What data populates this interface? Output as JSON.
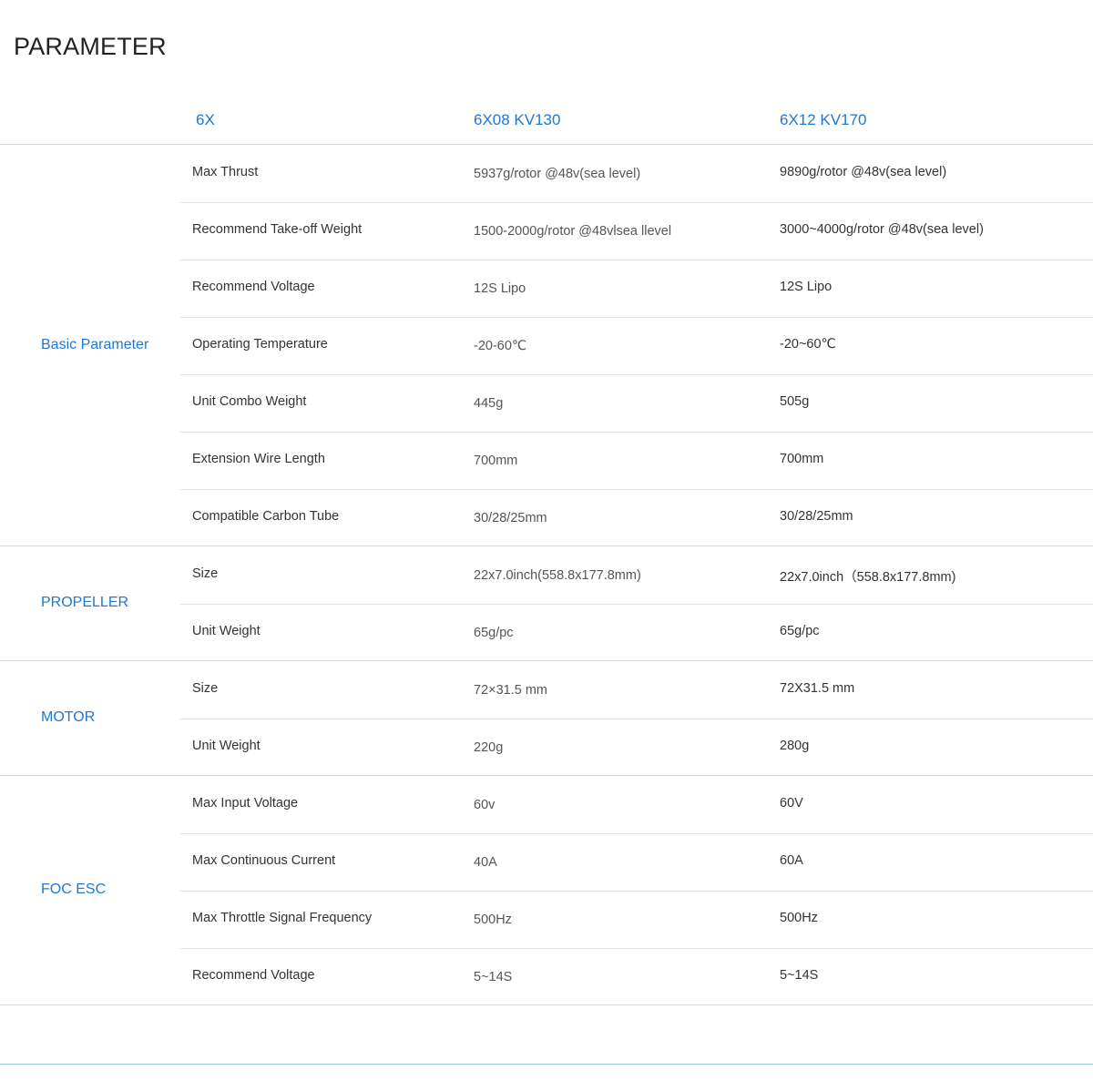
{
  "title": "PARAMETER",
  "header": {
    "col0": "6X",
    "col1": "6X08 KV130",
    "col2": "6X12 KV170"
  },
  "sections": [
    {
      "label": "Basic Parameter",
      "rows": [
        {
          "param": "Max Thrust",
          "v1": "5937g/rotor @48v(sea level)",
          "v2": "9890g/rotor @48v(sea level)"
        },
        {
          "param": "Recommend Take-off Weight",
          "v1": "1500-2000g/rotor @48vlsea llevel",
          "v2": "3000~4000g/rotor @48v(sea level)"
        },
        {
          "param": "Recommend Voltage",
          "v1": "12S Lipo",
          "v2": "12S Lipo"
        },
        {
          "param": "Operating Temperature",
          "v1": "-20-60℃",
          "v2": "-20~60℃"
        },
        {
          "param": "Unit Combo Weight",
          "v1": "445g",
          "v2": "505g"
        },
        {
          "param": "Extension Wire Length",
          "v1": "700mm",
          "v2": "700mm"
        },
        {
          "param": "Compatible Carbon Tube",
          "v1": "30/28/25mm",
          "v2": "30/28/25mm"
        }
      ]
    },
    {
      "label": "PROPELLER",
      "rows": [
        {
          "param": "Size",
          "v1": "22x7.0inch(558.8x177.8mm)",
          "v2": "22x7.0inch（558.8x177.8mm)"
        },
        {
          "param": "Unit Weight",
          "v1": "65g/pc",
          "v2": "65g/pc"
        }
      ]
    },
    {
      "label": "MOTOR",
      "rows": [
        {
          "param": "Size",
          "v1": "72×31.5 mm",
          "v2": "72X31.5 mm"
        },
        {
          "param": "Unit Weight",
          "v1": "220g",
          "v2": "280g"
        }
      ]
    },
    {
      "label": "FOC ESC",
      "rows": [
        {
          "param": "Max Input Voltage",
          "v1": "60v",
          "v2": "60V"
        },
        {
          "param": "Max Continuous Current",
          "v1": "40A",
          "v2": "60A"
        },
        {
          "param": "Max Throttle Signal Frequency",
          "v1": "500Hz",
          "v2": "500Hz"
        },
        {
          "param": "Recommend Voltage",
          "v1": "5~14S",
          "v2": "5~14S"
        }
      ]
    }
  ],
  "colors": {
    "accent": "#1e78d2",
    "rule": "#d8d8d8",
    "text": "#333333"
  }
}
